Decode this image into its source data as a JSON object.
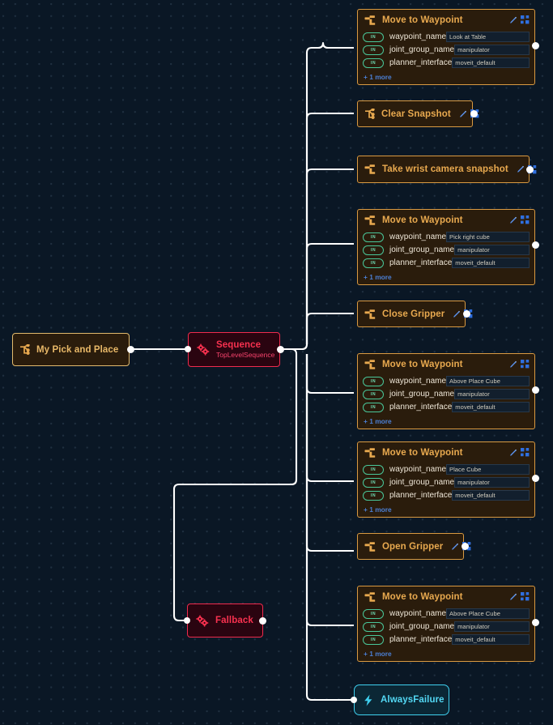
{
  "editor": {
    "name": "behavior-tree-canvas",
    "background_color": "#0a1725",
    "edge_color": "#ffffff"
  },
  "colors": {
    "action_border": "#d99a42",
    "action_title": "#e8a94f",
    "action_bg": "#2a1c0c",
    "control_border": "#ef2b4e",
    "control_title": "#f8314f",
    "control_bg": "#2a0410",
    "cyan_border": "#3fd0ef",
    "cyan_title": "#53d8f4",
    "cyan_bg": "#0b2735",
    "port_pill": "#49c79a",
    "more_link": "#4b7fd4",
    "icon_edit": "#3b82f6",
    "icon_expand": "#2f6fe0"
  },
  "labels": {
    "port_tag_in": "IN",
    "more_suffix": "+ 1 more",
    "edit_icon": "pencil-icon",
    "expand_icon": "expand-icon"
  },
  "nodes": [
    {
      "id": "root",
      "kind": "root",
      "title": "My Pick and Place",
      "icon": "behavior-tree-icon",
      "ports": [],
      "more": null
    },
    {
      "id": "sequence",
      "kind": "control",
      "title": "Sequence",
      "subtitle": "TopLevelSequence",
      "icon": "gears-icon",
      "ports": [],
      "more": null
    },
    {
      "id": "fallback",
      "kind": "control",
      "title": "Fallback",
      "subtitle": "",
      "icon": "gears-icon",
      "ports": [],
      "more": null
    },
    {
      "id": "move-look-at-table",
      "kind": "action",
      "title": "Move to Waypoint",
      "icon": "robot-arm-icon",
      "ports": [
        {
          "tag": "IN",
          "name": "waypoint_name",
          "value": "Look at Table"
        },
        {
          "tag": "IN",
          "name": "joint_group_name",
          "value": "manipulator"
        },
        {
          "tag": "IN",
          "name": "planner_interface",
          "value": "moveit_default"
        }
      ],
      "more": "+ 1 more"
    },
    {
      "id": "clear-snapshot",
      "kind": "action",
      "title": "Clear Snapshot",
      "icon": "behavior-tree-icon",
      "ports": [],
      "more": null
    },
    {
      "id": "take-wrist-camera-snapshot",
      "kind": "action",
      "title": "Take wrist camera snapshot",
      "icon": "robot-arm-icon",
      "ports": [],
      "more": null
    },
    {
      "id": "move-pick-right-cube",
      "kind": "action",
      "title": "Move to Waypoint",
      "icon": "robot-arm-icon",
      "ports": [
        {
          "tag": "IN",
          "name": "waypoint_name",
          "value": "Pick right cube"
        },
        {
          "tag": "IN",
          "name": "joint_group_name",
          "value": "manipulator"
        },
        {
          "tag": "IN",
          "name": "planner_interface",
          "value": "moveit_default"
        }
      ],
      "more": "+ 1 more"
    },
    {
      "id": "close-gripper",
      "kind": "action",
      "title": "Close Gripper",
      "icon": "robot-arm-icon",
      "ports": [],
      "more": null
    },
    {
      "id": "move-above-place-cube-1",
      "kind": "action",
      "title": "Move to Waypoint",
      "icon": "robot-arm-icon",
      "ports": [
        {
          "tag": "IN",
          "name": "waypoint_name",
          "value": "Above Place Cube"
        },
        {
          "tag": "IN",
          "name": "joint_group_name",
          "value": "manipulator"
        },
        {
          "tag": "IN",
          "name": "planner_interface",
          "value": "moveit_default"
        }
      ],
      "more": "+ 1 more"
    },
    {
      "id": "move-place-cube",
      "kind": "action",
      "title": "Move to Waypoint",
      "icon": "robot-arm-icon",
      "ports": [
        {
          "tag": "IN",
          "name": "waypoint_name",
          "value": "Place Cube"
        },
        {
          "tag": "IN",
          "name": "joint_group_name",
          "value": "manipulator"
        },
        {
          "tag": "IN",
          "name": "planner_interface",
          "value": "moveit_default"
        }
      ],
      "more": "+ 1 more"
    },
    {
      "id": "open-gripper",
      "kind": "action",
      "title": "Open Gripper",
      "icon": "robot-arm-icon",
      "ports": [],
      "more": null
    },
    {
      "id": "move-above-place-cube-2",
      "kind": "action",
      "title": "Move to Waypoint",
      "icon": "robot-arm-icon",
      "ports": [
        {
          "tag": "IN",
          "name": "waypoint_name",
          "value": "Above Place Cube"
        },
        {
          "tag": "IN",
          "name": "joint_group_name",
          "value": "manipulator"
        },
        {
          "tag": "IN",
          "name": "planner_interface",
          "value": "moveit_default"
        }
      ],
      "more": "+ 1 more"
    },
    {
      "id": "always-failure",
      "kind": "cyan",
      "title": "AlwaysFailure",
      "icon": "lightning-bolt-icon",
      "ports": [],
      "more": null
    }
  ]
}
